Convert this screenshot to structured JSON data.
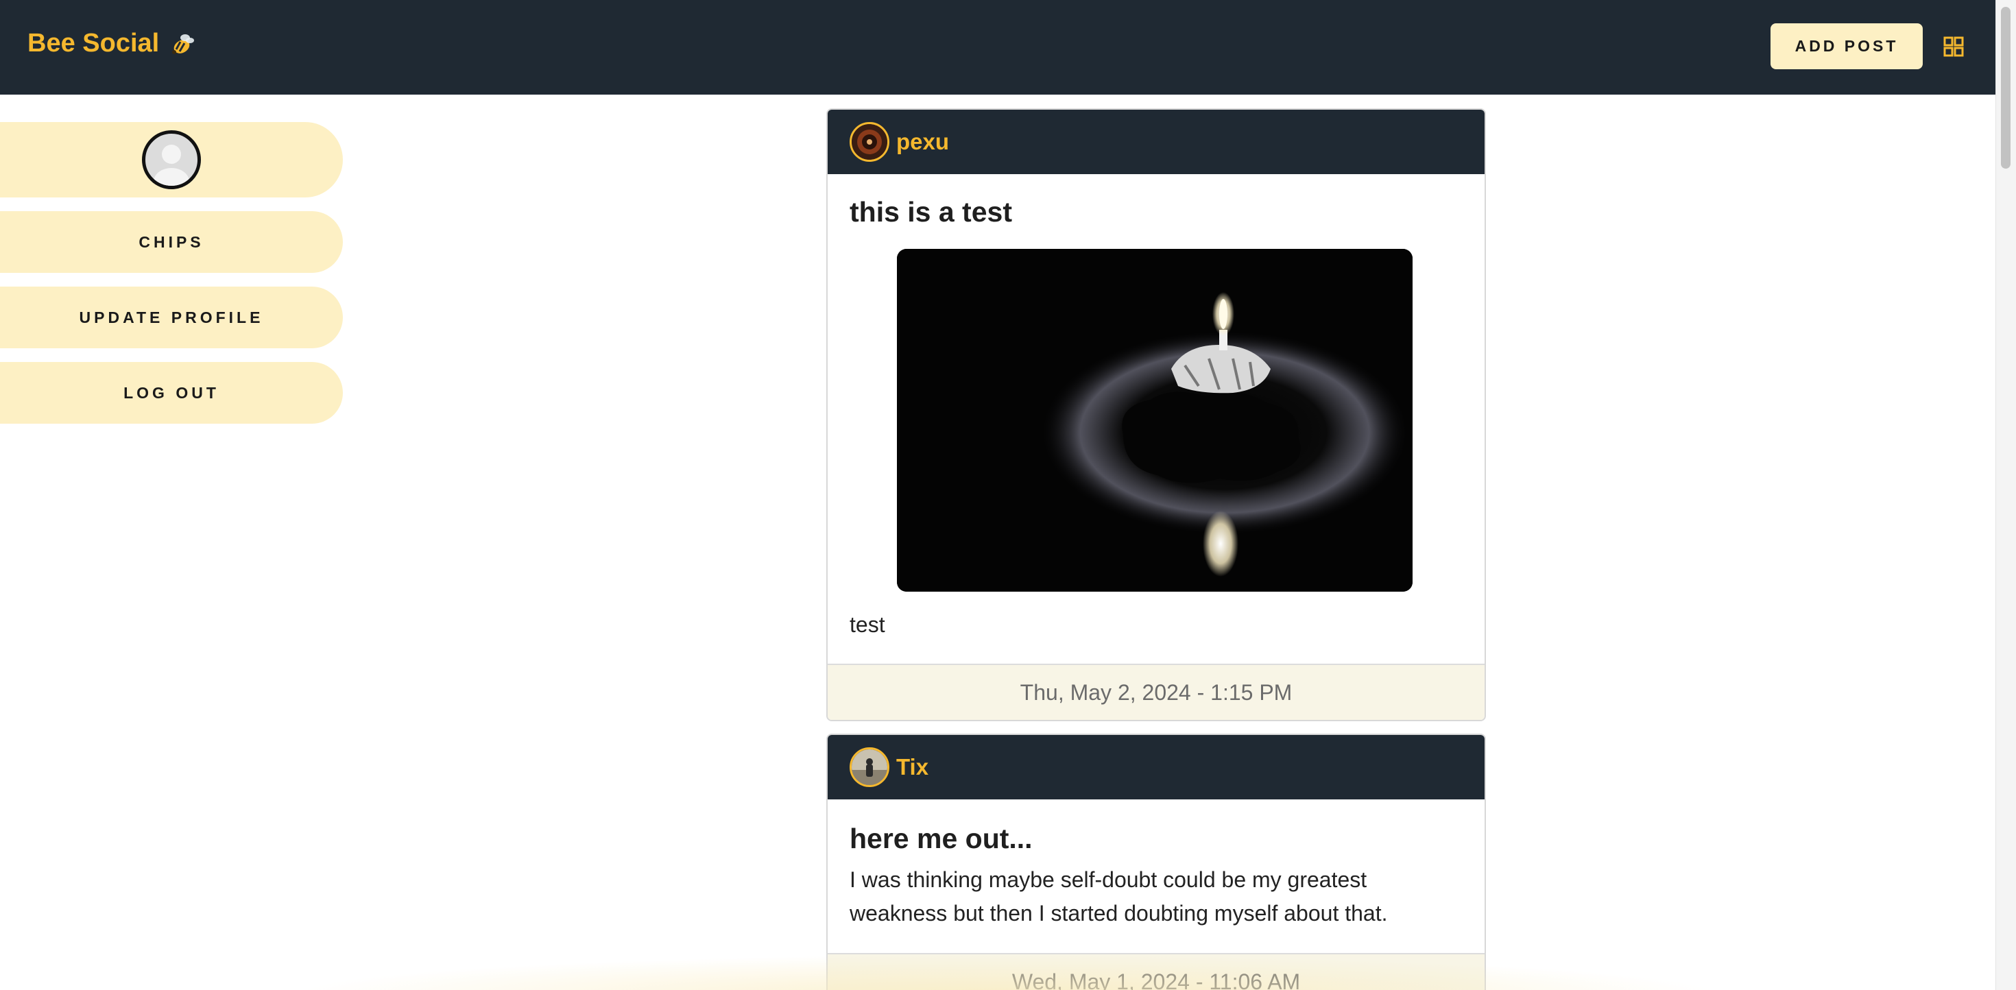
{
  "app": {
    "brand": "Bee Social",
    "add_post_label": "ADD POST"
  },
  "sidebar": {
    "items": [
      {
        "label": "CHIPS"
      },
      {
        "label": "UPDATE PROFILE"
      },
      {
        "label": "LOG OUT"
      }
    ]
  },
  "feed": {
    "posts": [
      {
        "user": "pexu",
        "title": "this is a test",
        "body": "test",
        "timestamp": "Thu, May 2, 2024 - 1:15 PM"
      },
      {
        "user": "Tix",
        "title": "here me out...",
        "body": "I was thinking maybe self-doubt could be my greatest weakness but then I started doubting myself about that.",
        "timestamp": "Wed, May 1, 2024 - 11:06 AM"
      }
    ]
  },
  "colors": {
    "topbar": "#1f2933",
    "brand_accent": "#f5b82e",
    "pill_bg": "#fdf0c4",
    "footer_bg": "#f8f5e6"
  },
  "icons": {
    "brand": "bee-icon",
    "menu": "grid-icon"
  }
}
